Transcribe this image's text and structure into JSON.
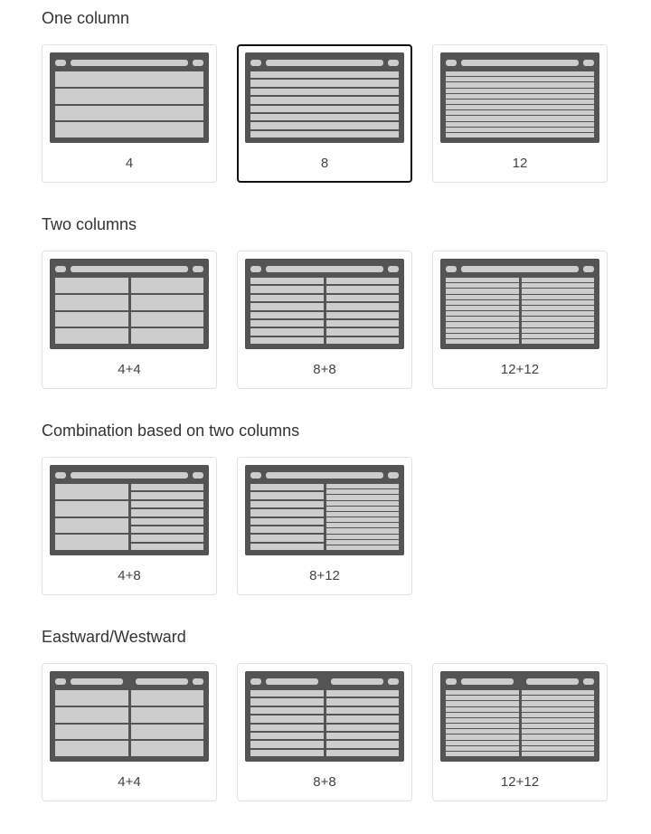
{
  "sections": [
    {
      "title": "One column",
      "cards": [
        {
          "label": "4",
          "columns": [
            4
          ],
          "header": "single",
          "selected": false
        },
        {
          "label": "8",
          "columns": [
            8
          ],
          "header": "single",
          "selected": true
        },
        {
          "label": "12",
          "columns": [
            12
          ],
          "header": "single",
          "selected": false
        }
      ]
    },
    {
      "title": "Two columns",
      "cards": [
        {
          "label": "4+4",
          "columns": [
            4,
            4
          ],
          "header": "single",
          "selected": false
        },
        {
          "label": "8+8",
          "columns": [
            8,
            8
          ],
          "header": "single",
          "selected": false
        },
        {
          "label": "12+12",
          "columns": [
            12,
            12
          ],
          "header": "single",
          "selected": false
        }
      ]
    },
    {
      "title": "Combination based on two columns",
      "cards": [
        {
          "label": "4+8",
          "columns": [
            4,
            8
          ],
          "header": "single",
          "selected": false
        },
        {
          "label": "8+12",
          "columns": [
            8,
            12
          ],
          "header": "single",
          "selected": false
        }
      ]
    },
    {
      "title": "Eastward/Westward",
      "cards": [
        {
          "label": "4+4",
          "columns": [
            4,
            4
          ],
          "header": "dual",
          "selected": false
        },
        {
          "label": "8+8",
          "columns": [
            8,
            8
          ],
          "header": "dual",
          "selected": false
        },
        {
          "label": "12+12",
          "columns": [
            12,
            12
          ],
          "header": "dual",
          "selected": false
        }
      ]
    }
  ]
}
